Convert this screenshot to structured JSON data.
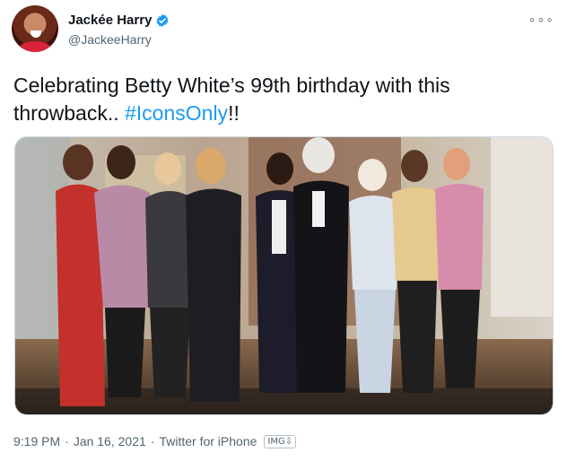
{
  "author": {
    "name": "Jackée Harry",
    "handle": "@JackeeHarry",
    "verified": true,
    "avatar_icon": "avatar-photo"
  },
  "more_icon": "more-options-icon",
  "more_glyph": "∘∘∘",
  "tweet": {
    "text_before": "Celebrating Betty White’s 99th birthday with this throwback.. ",
    "hashtag": "#IconsOnly",
    "text_after": "!!"
  },
  "media": {
    "type": "photo",
    "description_icon": "group-photo"
  },
  "footer": {
    "time": "9:19 PM",
    "separator": "·",
    "date": "Jan 16, 2021",
    "source": "Twitter for iPhone",
    "badge": "IMG⇩"
  },
  "colors": {
    "link": "#1d9bf0",
    "secondary_text": "#536471",
    "verified": "#1d9bf0"
  }
}
